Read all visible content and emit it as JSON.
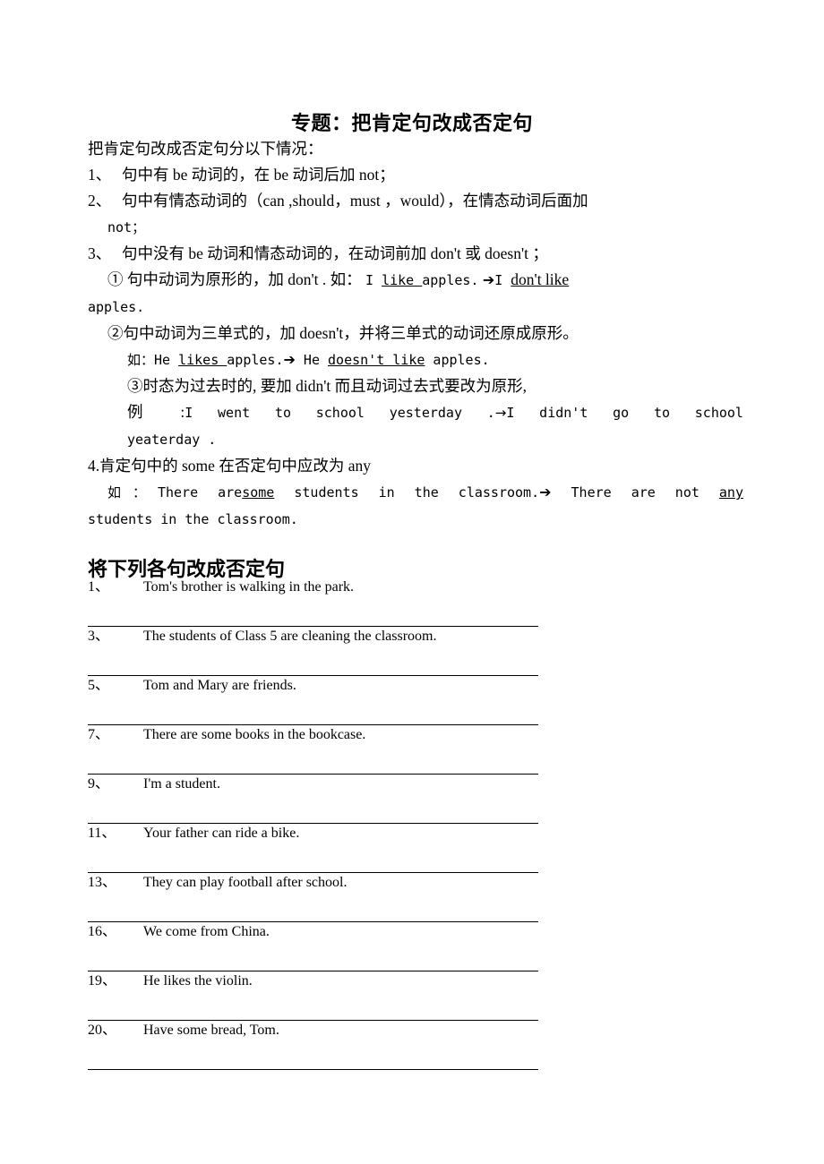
{
  "document": {
    "title": "专题：把肯定句改成否定句",
    "intro_lead": "把肯定句改成否定句分以下情况：",
    "rules": [
      {
        "num": "1、",
        "text": "句中有 be 动词的，在 be 动词后加 not；"
      },
      {
        "num": "2、",
        "text": "句中有情态动词的（can ,should，must ，would），在情态动词后面加",
        "cont": "not；"
      },
      {
        "num": "3、",
        "text": "句中没有 be 动词和情态动词的，在动词前加 don't 或 doesn't ；"
      }
    ],
    "sub_rules": {
      "one_label": "①",
      "one_text": "句中动词为原形的，加 don't . 如：",
      "one_example_before_a": "I ",
      "one_example_before_b": "like ",
      "one_example_before_c": "apples.",
      "one_arrow": "➔",
      "one_example_after_a": "I ",
      "one_example_after_b": "don't like",
      "one_example_after_tail": "apples.",
      "two_label": "②",
      "two_text": "句中动词为三单式的，加 doesn't，并将三单式的动词还原成原形。",
      "two_ex_prefix": "如：He ",
      "two_ex_verb": "likes ",
      "two_ex_obj": "apples.",
      "two_arrow": "➔",
      "two_ex_after_subj": " He ",
      "two_ex_after_verb": "doesn't like",
      "two_ex_after_obj": " apples.",
      "three_label": "③",
      "three_text": "时态为过去时的, 要加 didn't  而且动词过去式要改为原形,",
      "three_ex_label": "例 :",
      "three_ex_before": "I went to school yesterday .",
      "three_arrow": "→",
      "three_ex_after": "I didn't  go to school",
      "three_ex_after_tail": "yeaterday ."
    },
    "rule_four": {
      "text": "4.肯定句中的 some 在否定句中应改为 any",
      "ex_prefix": "如：There are",
      "ex_some": "some",
      "ex_mid": " students in the classroom.",
      "arrow": "➔",
      "ex_after": " There are not ",
      "ex_any": "any",
      "ex_tail": "students in the classroom."
    },
    "section_heading": "将下列各句改成否定句",
    "exercises": [
      {
        "num": "1、",
        "text": "Tom's brother is walking in the park."
      },
      {
        "num": "3、",
        "text": "The students of Class 5 are cleaning the classroom."
      },
      {
        "num": "5、",
        "text": "Tom and Mary are friends."
      },
      {
        "num": "7、",
        "text": "There are some books in the bookcase."
      },
      {
        "num": "9、",
        "text": "I'm a student."
      },
      {
        "num": "11、",
        "text": "Your father can ride a bike."
      },
      {
        "num": "13、",
        "text": "They can play football after school."
      },
      {
        "num": "16、",
        "text": "We come from China."
      },
      {
        "num": "19、",
        "text": "He likes the violin."
      },
      {
        "num": "20、",
        "text": "Have some bread, Tom."
      }
    ],
    "colors": {
      "text": "#000000",
      "background": "#ffffff",
      "rule_line": "#000000"
    }
  }
}
